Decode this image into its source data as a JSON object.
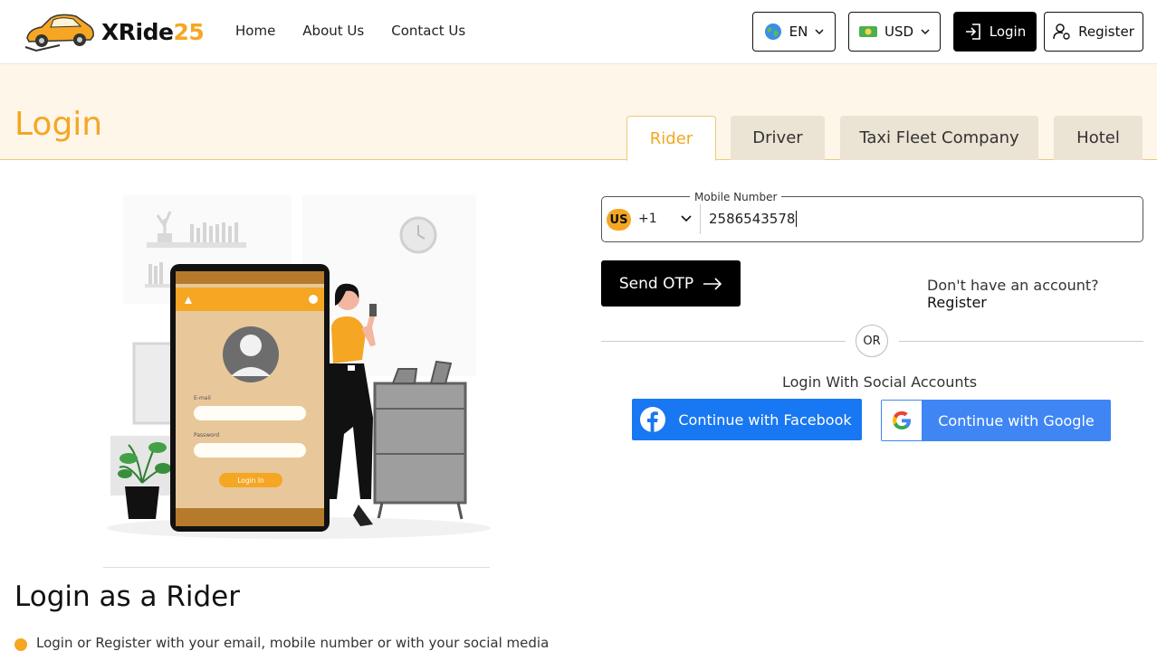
{
  "header": {
    "brand_primary": "XRide",
    "brand_secondary": "25",
    "nav": [
      "Home",
      "About Us",
      "Contact Us"
    ],
    "language": "EN",
    "currency": "USD",
    "login_label": "Login",
    "register_label": "Register"
  },
  "banner": {
    "title": "Login",
    "tabs": [
      {
        "label": "Rider",
        "active": true
      },
      {
        "label": "Driver",
        "active": false
      },
      {
        "label": "Taxi Fleet Company",
        "active": false
      },
      {
        "label": "Hotel",
        "active": false
      }
    ]
  },
  "illustration": {
    "email_label": "E-mail",
    "password_label": "Password",
    "button_label": "Login In"
  },
  "form": {
    "phone_label": "Mobile Number",
    "country_badge": "US",
    "country_code": "+1",
    "phone_value": "2586543578",
    "send_otp_label": "Send OTP",
    "no_account_text": "Don't have an account?",
    "register_link": "Register",
    "or_text": "OR",
    "social_title": "Login With Social Accounts",
    "facebook_label": "Continue with Facebook",
    "google_label": "Continue with Google"
  },
  "content": {
    "role_heading": "Login as a Rider",
    "bullet_text": "Login or Register with your email, mobile number or with your social media"
  },
  "colors": {
    "accent": "#f5a623",
    "banner_bg": "#fdf6e9",
    "facebook": "#1877f2",
    "google": "#3f86f4"
  }
}
